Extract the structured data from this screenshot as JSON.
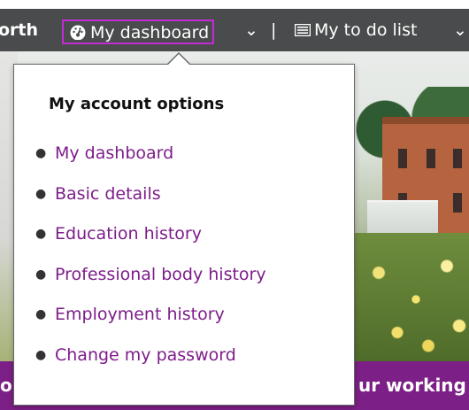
{
  "topbar": {
    "user_fragment": "orth",
    "dashboard_label": "My dashboard",
    "separator": "|",
    "todo_label": "My to do list",
    "caret": "⌄"
  },
  "banner": {
    "left_text": "o",
    "right_text": "ur working"
  },
  "dropdown": {
    "heading": "My account options",
    "items": [
      {
        "label": "My dashboard"
      },
      {
        "label": "Basic details"
      },
      {
        "label": "Education history"
      },
      {
        "label": "Professional body history"
      },
      {
        "label": "Employment history"
      },
      {
        "label": "Change my password"
      }
    ]
  },
  "colors": {
    "topbar_bg": "#4a4b4c",
    "link": "#7d1d8a",
    "focus_border": "#c22ad6",
    "band": "#7c1f86"
  },
  "icons": [
    "dashboard-gauge-icon",
    "chevron-down-icon",
    "list-icon"
  ]
}
